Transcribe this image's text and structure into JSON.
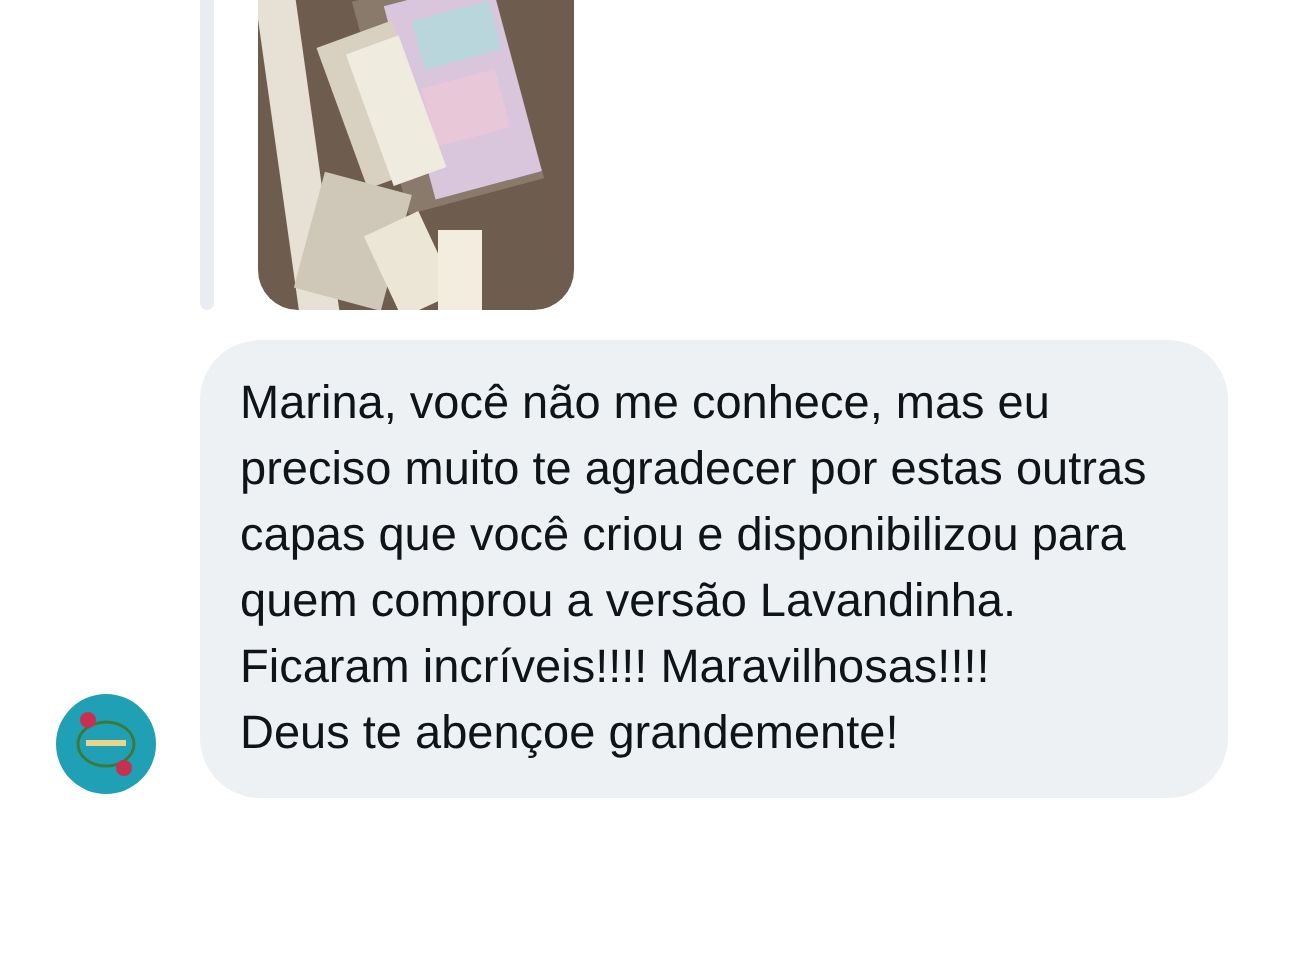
{
  "message": {
    "paragraphs": [
      "Marina, você não me conhece, mas eu preciso muito te agradecer por estas outras capas que você criou e disponibilizou para quem comprou a versão Lavandinha.",
      "Ficaram incríveis!!!! Maravilhosas!!!!",
      "Deus te abençoe grandemente!"
    ]
  }
}
